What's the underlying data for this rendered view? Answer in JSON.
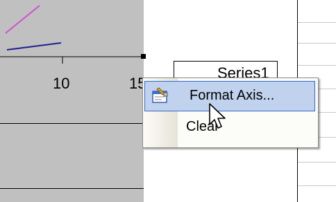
{
  "chart": {
    "x_tick_labels": [
      "10",
      "15"
    ],
    "legend_series": "Series1",
    "series_colors": [
      "#d04fd0",
      "#1f1f8f"
    ],
    "plot_background": "#c0c0c0"
  },
  "context_menu": {
    "items": [
      {
        "label": "Format Axis...",
        "icon": "format-axis-icon",
        "selected": true
      },
      {
        "label": "Clear",
        "selected": false
      }
    ],
    "highlight_color": "#c1d2ee",
    "highlight_border": "#316ac5"
  },
  "cursor": "arrow-pointer"
}
